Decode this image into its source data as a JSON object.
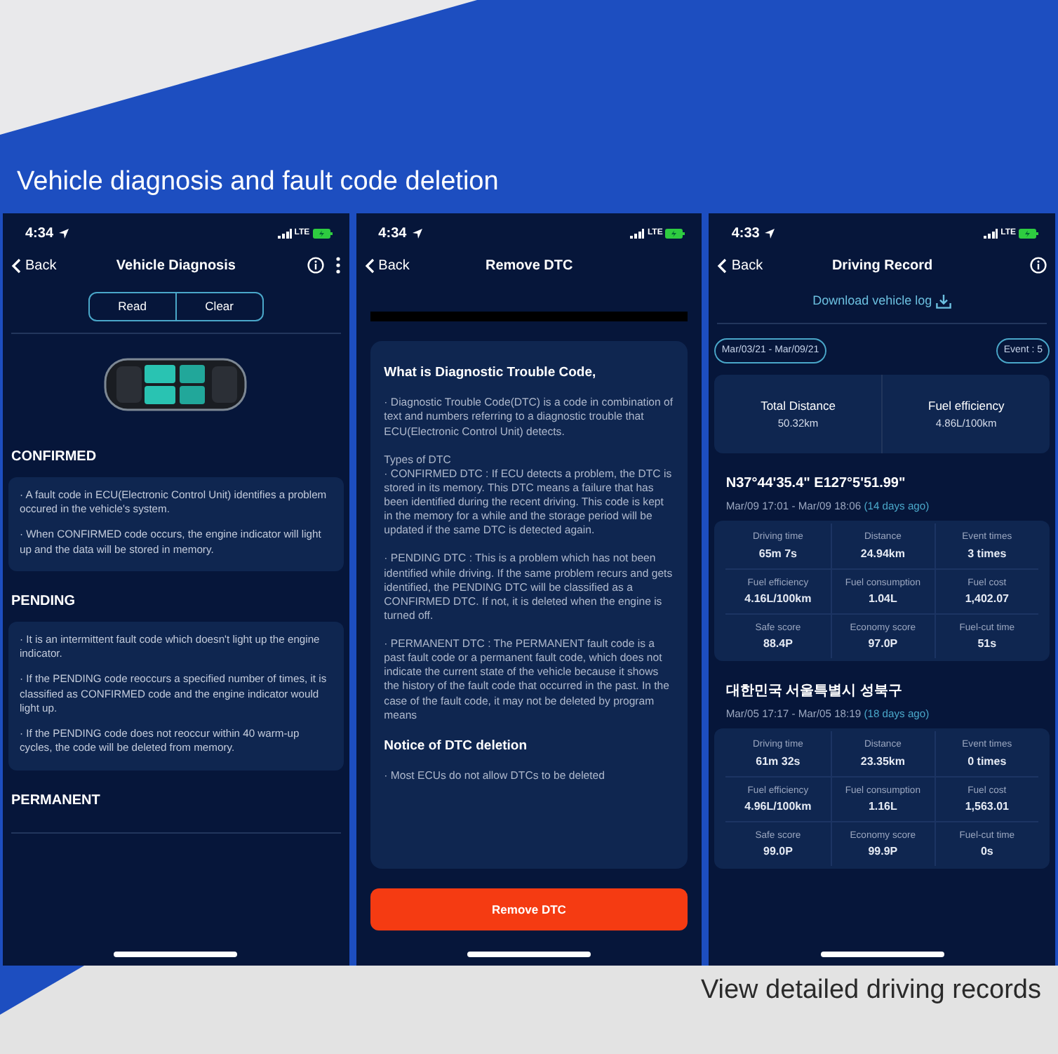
{
  "banner": {
    "title": "Vehicle diagnosis and fault code deletion"
  },
  "diagnosis_screen": {
    "status_bar": {
      "time": "4:34",
      "network": "LTE"
    },
    "back": "Back",
    "title": "Vehicle Diagnosis",
    "tabs": [
      {
        "label": "Read",
        "selected": false
      },
      {
        "label": "Clear",
        "selected": false
      }
    ],
    "sections": [
      {
        "heading": "CONFIRMED",
        "paragraphs": [
          "· A fault code in ECU(Electronic Control Unit) identifies a problem occured in the vehicle's system.",
          "· When CONFIRMED code occurs, the engine indicator will light up and the data will be stored in memory."
        ]
      },
      {
        "heading": "PENDING",
        "paragraphs": [
          "· It is an intermittent fault code which doesn't light up the engine indicator.",
          "· If the PENDING code reoccurs a specified number of times, it is classified as CONFIRMED code and the engine indicator would light up.",
          "· If the PENDING code does not reoccur within 40 warm-up cycles, the code will be deleted from memory."
        ]
      },
      {
        "heading": "PERMANENT"
      }
    ]
  },
  "remove_dtc_screen": {
    "status_bar": {
      "time": "4:34",
      "network": "LTE"
    },
    "back": "Back",
    "title": "Remove DTC",
    "blocks": [
      {
        "kind": "heading",
        "text": "What is Diagnostic Trouble Code,"
      },
      {
        "kind": "text",
        "text": "· Diagnostic Trouble Code(DTC) is a code in combination of text and numbers referring to a diagnostic trouble that ECU(Electronic Control Unit) detects."
      },
      {
        "kind": "text",
        "text": "Types of DTC\n· CONFIRMED DTC : If ECU detects a problem, the DTC is stored in its memory. This DTC means a failure that has been identified during the recent driving. This code is kept in the memory for a while and the storage period will be updated if the same DTC is detected again."
      },
      {
        "kind": "text",
        "text": "· PENDING DTC : This is a problem which has not been identified while driving. If the same problem recurs and gets identified, the PENDING DTC will be classified as a CONFIRMED DTC. If not, it is deleted when the engine is turned off."
      },
      {
        "kind": "text",
        "text": "· PERMANENT DTC : The PERMANENT fault code is a past fault code or a permanent fault code, which does not indicate the current state of the vehicle because it shows the history of the fault code that occurred in the past. In the case of the fault code, it may not be deleted by program means"
      },
      {
        "kind": "heading",
        "text": "Notice of DTC deletion"
      },
      {
        "kind": "text",
        "text": "· Most ECUs do not allow DTCs to be deleted"
      }
    ],
    "button": "Remove DTC"
  },
  "driving_record_screen": {
    "status_bar": {
      "time": "4:33",
      "network": "LTE"
    },
    "back": "Back",
    "title": "Driving Record",
    "download": "Download vehicle log",
    "date_range": "Mar/03/21 - Mar/09/21",
    "events": "Event : 5",
    "summary": [
      {
        "label": "Total Distance",
        "value": "50.32km"
      },
      {
        "label": "Fuel efficiency",
        "value": "4.86L/100km"
      }
    ],
    "records": [
      {
        "place": "N37°44'35.4\" E127°5'51.99\"",
        "period": "Mar/09 17:01 - Mar/09 18:06",
        "ago": "(14 days ago)",
        "stats": [
          {
            "label": "Driving time",
            "value": "65m 7s"
          },
          {
            "label": "Distance",
            "value": "24.94km"
          },
          {
            "label": "Event times",
            "value": "3 times"
          },
          {
            "label": "Fuel efficiency",
            "value": "4.16L/100km"
          },
          {
            "label": "Fuel consumption",
            "value": "1.04L"
          },
          {
            "label": "Fuel cost",
            "value": "1,402.07"
          },
          {
            "label": "Safe score",
            "value": "88.4P"
          },
          {
            "label": "Economy score",
            "value": "97.0P"
          },
          {
            "label": "Fuel-cut time",
            "value": "51s"
          }
        ]
      },
      {
        "place": "대한민국 서울특별시 성북구",
        "period": "Mar/05 17:17 - Mar/05 18:19",
        "ago": "(18 days ago)",
        "stats": [
          {
            "label": "Driving time",
            "value": "61m 32s"
          },
          {
            "label": "Distance",
            "value": "23.35km"
          },
          {
            "label": "Event times",
            "value": "0 times"
          },
          {
            "label": "Fuel efficiency",
            "value": "4.96L/100km"
          },
          {
            "label": "Fuel consumption",
            "value": "1.16L"
          },
          {
            "label": "Fuel cost",
            "value": "1,563.01"
          },
          {
            "label": "Safe score",
            "value": "99.0P"
          },
          {
            "label": "Economy score",
            "value": "99.9P"
          },
          {
            "label": "Fuel-cut time",
            "value": "0s"
          }
        ]
      }
    ]
  },
  "footer": {
    "caption": "View detailed driving records"
  }
}
